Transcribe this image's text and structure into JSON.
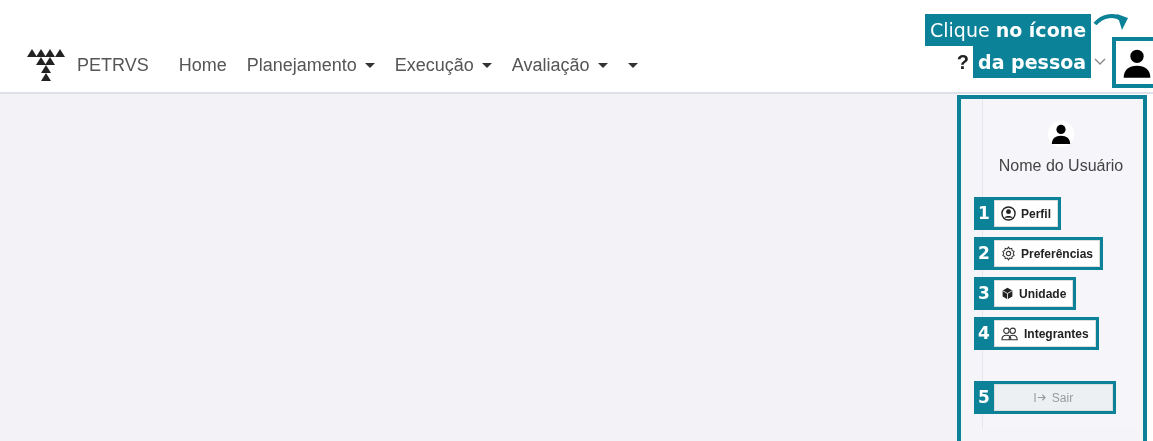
{
  "navbar": {
    "brand": "PETRVS",
    "items": [
      {
        "label": "Home",
        "dropdown": false
      },
      {
        "label": "Planejamento",
        "dropdown": true
      },
      {
        "label": "Execução",
        "dropdown": true
      },
      {
        "label": "Avaliação",
        "dropdown": true
      }
    ],
    "overflow_caret": true,
    "help": "?"
  },
  "callout": {
    "lines": [
      {
        "text": "Clique **no ícone**",
        "bold": false
      },
      {
        "text": "da pessoa",
        "bold": true
      }
    ]
  },
  "user_panel": {
    "name": "Nome do Usuário",
    "items": [
      {
        "number": "1",
        "label": "Perfil",
        "kind": "profile",
        "disabled": false
      },
      {
        "number": "2",
        "label": "Preferências",
        "kind": "settings",
        "disabled": false
      },
      {
        "number": "3",
        "label": "Unidade",
        "kind": "unit",
        "disabled": false
      },
      {
        "number": "4",
        "label": "Integrantes",
        "kind": "members",
        "disabled": false
      },
      {
        "number": "5",
        "label": "Sair",
        "kind": "logout",
        "disabled": true
      }
    ]
  }
}
